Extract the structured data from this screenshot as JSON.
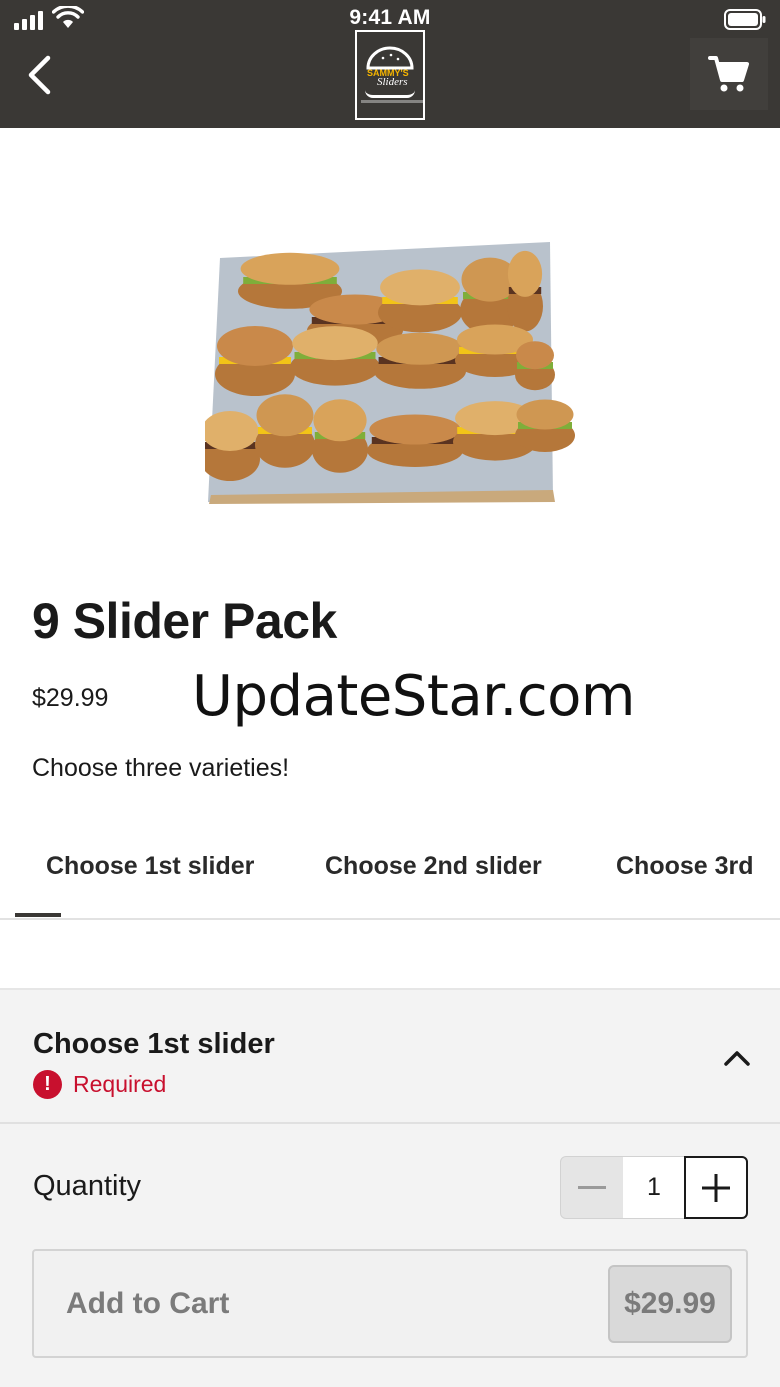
{
  "status_bar": {
    "time": "9:41 AM"
  },
  "header": {
    "logo_line1": "SAMMY'S",
    "logo_line2": "Sliders",
    "back_icon": "chevron-left-icon",
    "cart_icon": "shopping-cart-icon",
    "background_color": "#3a3835"
  },
  "product": {
    "image_alt": "box of nine sliders",
    "title": "9 Slider Pack",
    "price": "$29.99",
    "description": "Choose three varieties!"
  },
  "watermark": "UpdateStar.com",
  "tabs": [
    {
      "label": "Choose 1st slider",
      "active": true
    },
    {
      "label": "Choose 2nd slider",
      "active": false
    },
    {
      "label": "Choose 3rd",
      "active": false
    }
  ],
  "option_section": {
    "title": "Choose 1st slider",
    "required_label": "Required",
    "required_color": "#c8102e",
    "expanded": true
  },
  "quantity": {
    "label": "Quantity",
    "value": "1"
  },
  "add_to_cart": {
    "label": "Add to Cart",
    "price": "$29.99",
    "enabled": false
  }
}
